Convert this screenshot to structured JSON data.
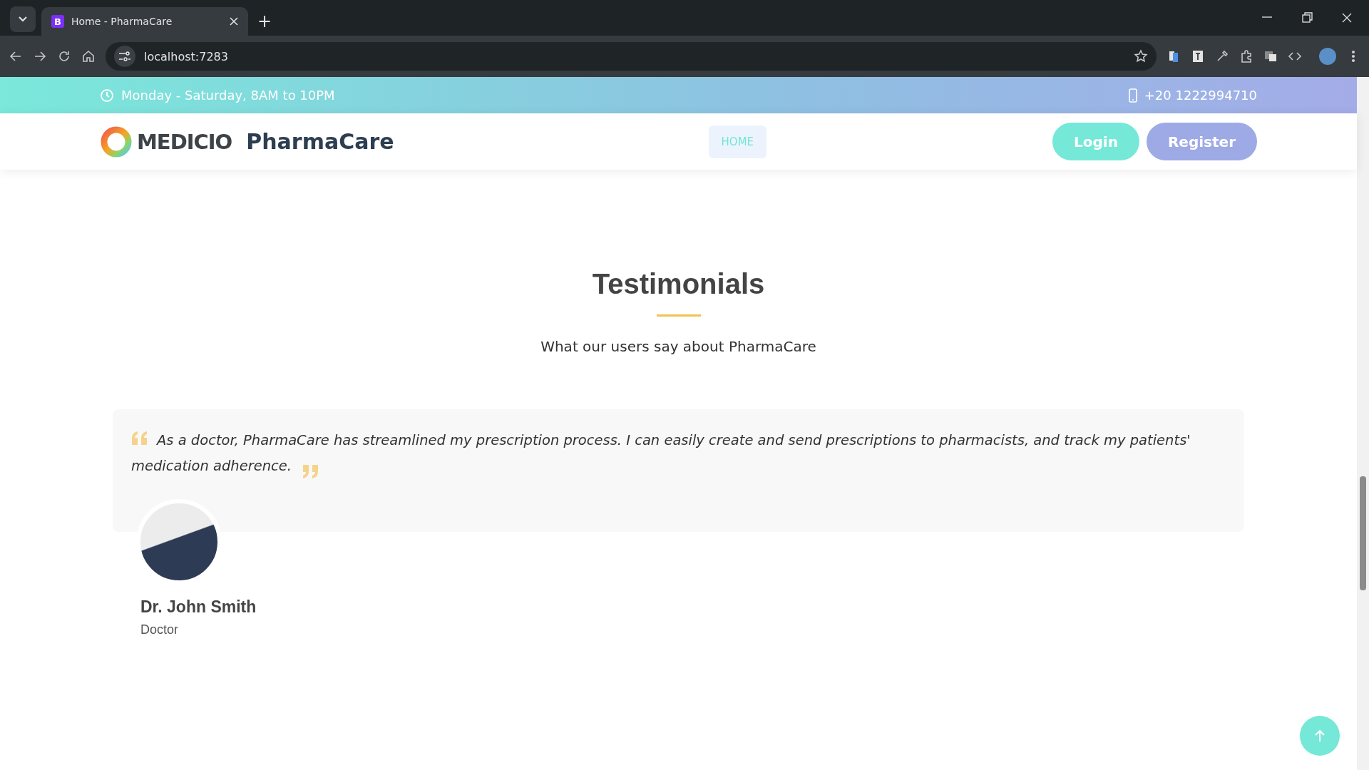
{
  "browser": {
    "tabs": [
      {
        "icon_letter": "B",
        "title": "Home - PharmaCare",
        "selected": true
      }
    ],
    "new_tab": "+",
    "address": "localhost:7283"
  },
  "topbar": {
    "hours": "Monday - Saturday, 8AM to 10PM",
    "phone": "+20 1222994710"
  },
  "header": {
    "logo": "MEDICIO",
    "brand": "PharmaCare",
    "nav": [
      {
        "label": "HOME",
        "selected": true
      }
    ],
    "buttons": [
      {
        "label": "Login",
        "kind": "login"
      },
      {
        "label": "Register",
        "kind": "register"
      }
    ]
  },
  "testimonials": {
    "title": "Testimonials",
    "subtitle": "What our users say about PharmaCare",
    "items": [
      {
        "quote": "As a doctor, PharmaCare has streamlined my prescription process. I can easily create and send prescriptions to pharmacists, and track my patients' medication adherence.",
        "name": "Dr. John Smith",
        "role": "Doctor"
      }
    ]
  }
}
